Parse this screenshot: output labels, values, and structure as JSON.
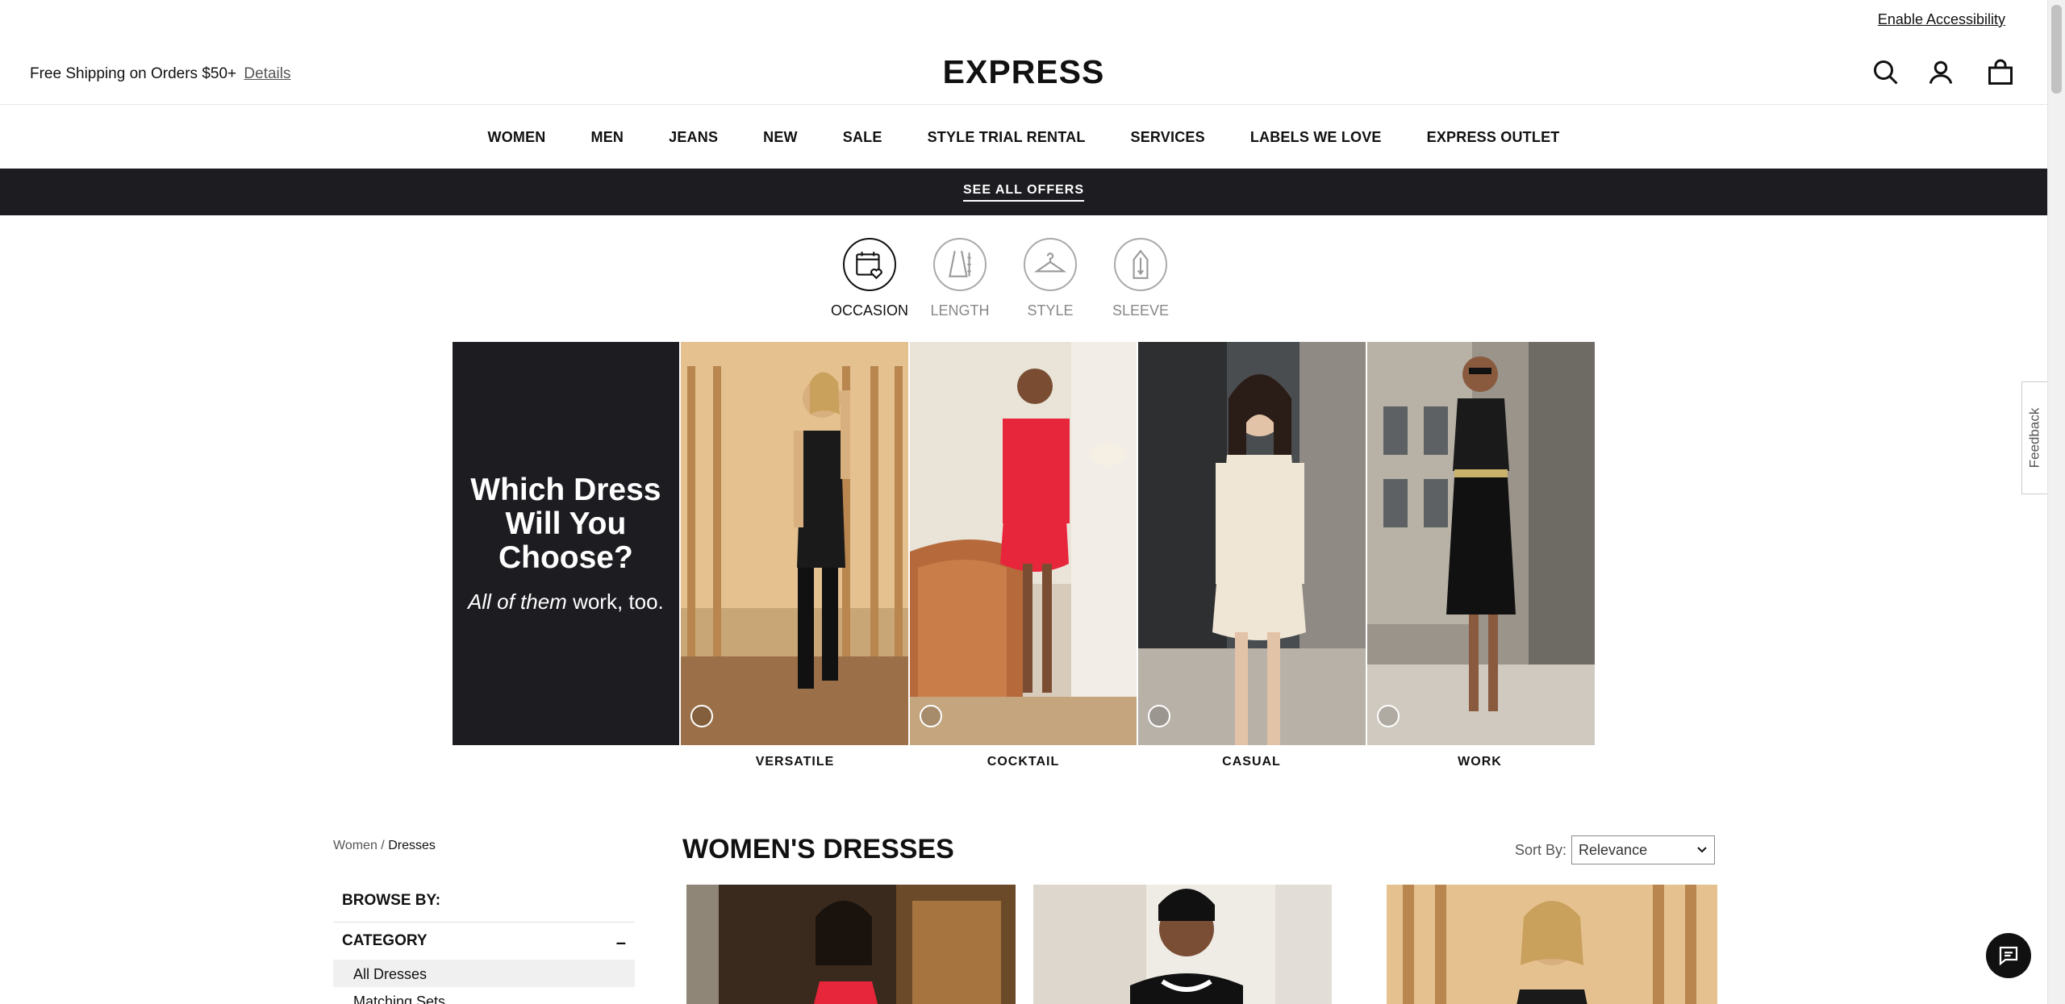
{
  "utility": {
    "accessibility_link": "Enable Accessibility"
  },
  "header": {
    "shipping_text": "Free Shipping on Orders $50+",
    "details_link": "Details",
    "logo": "EXPRESS",
    "icons": [
      "search-icon",
      "account-icon",
      "bag-icon"
    ]
  },
  "nav": {
    "items": [
      "WOMEN",
      "MEN",
      "JEANS",
      "NEW",
      "SALE",
      "STYLE TRIAL RENTAL",
      "SERVICES",
      "LABELS WE LOVE",
      "EXPRESS OUTLET"
    ]
  },
  "offers": {
    "label": "SEE ALL OFFERS"
  },
  "filters": [
    {
      "label": "OCCASION",
      "icon": "calendar-heart-icon",
      "active": true
    },
    {
      "label": "LENGTH",
      "icon": "dress-length-icon",
      "active": false
    },
    {
      "label": "STYLE",
      "icon": "hanger-icon",
      "active": false
    },
    {
      "label": "SLEEVE",
      "icon": "sleeve-icon",
      "active": false
    }
  ],
  "hero": {
    "promo_title": "Which Dress Will You Choose?",
    "promo_sub_italic": "All of them",
    "promo_sub_rest": "work, too.",
    "panels": [
      "VERSATILE",
      "COCKTAIL",
      "CASUAL",
      "WORK"
    ]
  },
  "breadcrumb": {
    "parent": "Women",
    "separator": "/",
    "current": "Dresses"
  },
  "sidebar": {
    "browse_by": "BROWSE BY:",
    "category_label": "CATEGORY",
    "items": [
      "All Dresses",
      "Matching Sets"
    ]
  },
  "main": {
    "title": "WOMEN'S DRESSES",
    "sort_label": "Sort By:",
    "sort_value": "Relevance"
  },
  "feedback": {
    "label": "Feedback"
  },
  "colors": {
    "dark_bar": "#1d1c21",
    "accent_red": "#e8263b"
  }
}
